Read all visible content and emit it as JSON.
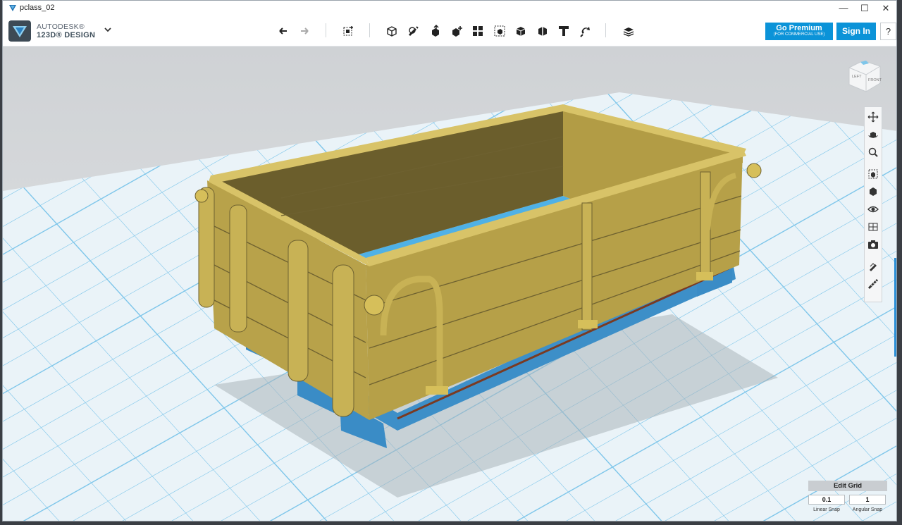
{
  "window": {
    "title": "pclass_02",
    "minimize": "—",
    "maximize": "☐",
    "close": "✕"
  },
  "toolbar": {
    "brand_line1": "AUTODESK®",
    "brand_line2": "123D® DESIGN",
    "menu_chevron_icon": "chevron-down-icon",
    "tools": [
      {
        "name": "undo-icon"
      },
      {
        "name": "redo-icon"
      },
      {
        "name": "transform-icon"
      },
      {
        "name": "primitives-icon"
      },
      {
        "name": "sketch-icon"
      },
      {
        "name": "construct-icon"
      },
      {
        "name": "modify-icon"
      },
      {
        "name": "pattern-icon"
      },
      {
        "name": "grouping-icon"
      },
      {
        "name": "combine-icon"
      },
      {
        "name": "measure-icon"
      },
      {
        "name": "text-icon"
      },
      {
        "name": "snap-icon"
      },
      {
        "name": "material-icon"
      }
    ],
    "go_premium_label": "Go Premium",
    "go_premium_sub": "(FOR COMMERCIAL USE)",
    "sign_in_label": "Sign In",
    "help_label": "?"
  },
  "viewcube": {
    "left_face": "LEFT",
    "front_face": "FRONT"
  },
  "navbar": {
    "buttons": [
      "pan-icon",
      "orbit-icon",
      "zoom-icon",
      "fit-icon",
      "perspective-icon",
      "visibility-icon",
      "materials-icon",
      "screenshot-icon",
      "snap-tool-icon",
      "ruler-icon"
    ]
  },
  "grid_panel": {
    "title": "Edit Grid",
    "linear_snap_value": "0.1",
    "angular_snap_value": "1",
    "linear_snap_label": "Linear Snap",
    "angular_snap_label": "Angular Snap"
  },
  "colors": {
    "accent": "#0b93d8",
    "wood": "#b8a24a",
    "wood_dark": "#6e6130",
    "steel_blue": "#3d8fc8",
    "grid_line": "#7ec6ea",
    "floor": "#e8f1f6",
    "background": "#d9dcdf"
  }
}
